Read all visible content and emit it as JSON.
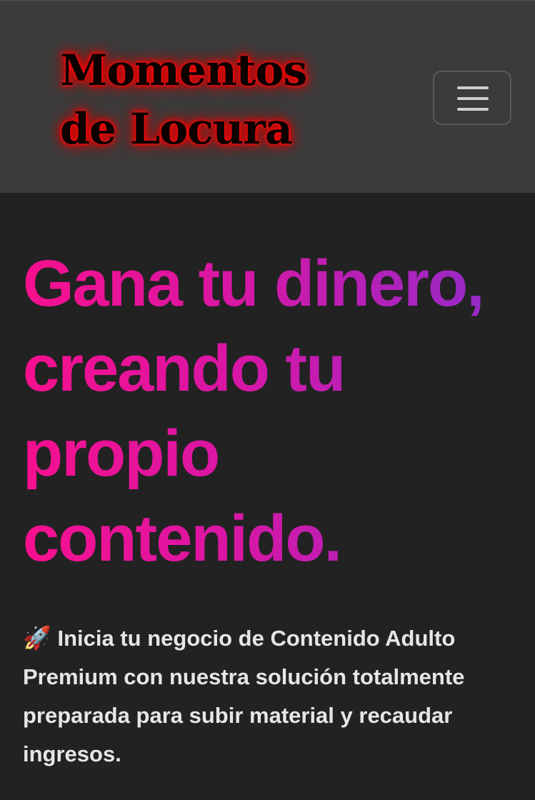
{
  "navbar": {
    "logo_lines": [
      "Momentos",
      "de Locura"
    ],
    "menu_icon": "hamburger-menu-icon"
  },
  "hero": {
    "headline_lines": [
      "Gana tu dinero,",
      "creando tu",
      "propio",
      "contenido."
    ],
    "lead_icon": "🚀",
    "lead_text": "Inicia tu negocio de Contenido Adulto Premium con nuestra solución totalmente preparada para subir material y recaudar ingresos."
  },
  "colors": {
    "navbar_bg": "#3b3b3b",
    "page_bg": "#222222",
    "headline_gradient_start": "#f7108e",
    "headline_gradient_end": "#8f2ccc",
    "logo_glow": "#ff0000",
    "lead_text": "#e6e6e6"
  }
}
